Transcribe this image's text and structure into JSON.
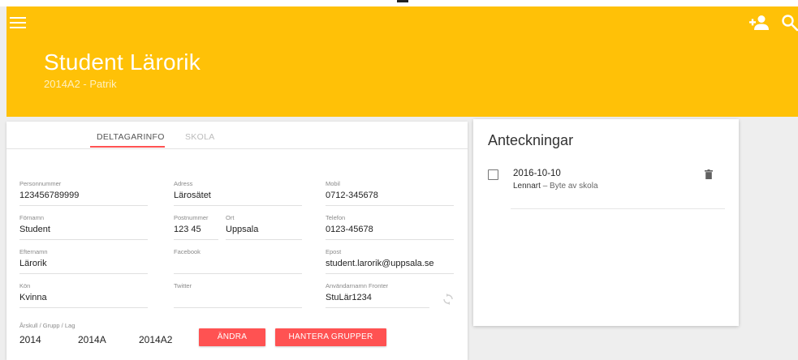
{
  "header": {
    "title": "Student Lärorik",
    "subtitle": "2014A2 - Patrik"
  },
  "icons": {
    "menu": "menu-icon",
    "add_person": "person-add-icon",
    "search": "search-icon",
    "sync": "sync-icon",
    "trash": "trash-icon"
  },
  "colors": {
    "header_bg": "#ffc107",
    "accent": "#ff5252"
  },
  "tabs": [
    {
      "label": "DELTAGARINFO",
      "active": true
    },
    {
      "label": "SKOLA",
      "active": false
    }
  ],
  "fields": {
    "personnummer": {
      "label": "Personnummer",
      "value": "123456789999"
    },
    "adress": {
      "label": "Adress",
      "value": "Lärosätet"
    },
    "mobil": {
      "label": "Mobil",
      "value": "0712-345678"
    },
    "fornamn": {
      "label": "Förnamn",
      "value": "Student"
    },
    "postnummer": {
      "label": "Postnummer",
      "value": "123 45"
    },
    "ort": {
      "label": "Ort",
      "value": "Uppsala"
    },
    "telefon": {
      "label": "Telefon",
      "value": "0123-45678"
    },
    "efternamn": {
      "label": "Efternamn",
      "value": "Lärorik"
    },
    "facebook": {
      "label": "Facebook",
      "value": ""
    },
    "epost": {
      "label": "Epost",
      "value": "student.larorik@uppsala.se"
    },
    "kon": {
      "label": "Kön",
      "value": "Kvinna"
    },
    "twitter": {
      "label": "Twitter",
      "value": ""
    },
    "anvandarnamn": {
      "label": "Användarnamn Fronter",
      "value": "StuLär1234"
    }
  },
  "group": {
    "label": "Årskull / Grupp / Lag",
    "arskull": "2014",
    "grupp": "2014A",
    "lag": "2014A2"
  },
  "buttons": {
    "andra": "ÄNDRA",
    "hantera_grupper": "HANTERA GRUPPER"
  },
  "notes": {
    "title": "Anteckningar",
    "items": [
      {
        "date": "2016-10-10",
        "author": "Lennart",
        "text": " – Byte av skola"
      }
    ]
  }
}
